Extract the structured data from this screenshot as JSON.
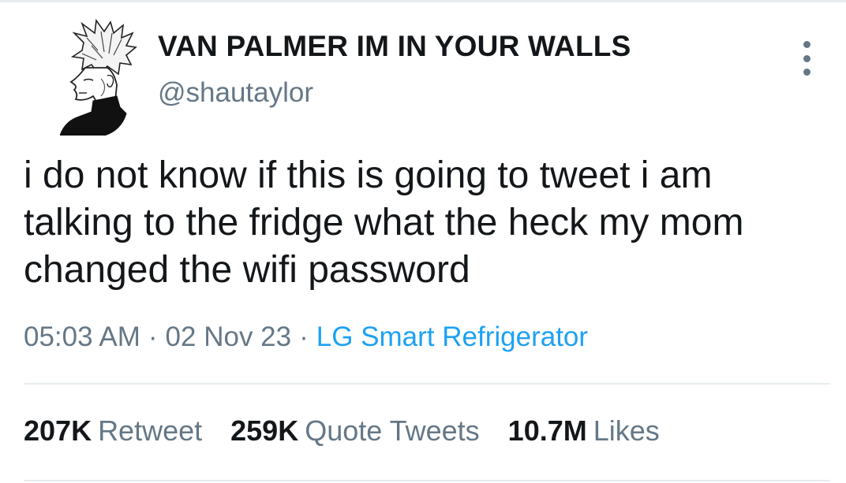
{
  "tweet": {
    "display_name": "VAN PALMER IM IN YOUR WALLS",
    "handle": "@shautaylor",
    "text": "i do not know if this is going to tweet i am talking to the fridge what the heck my mom changed the wifi password",
    "time": "05:03 AM",
    "date": "02 Nov 23",
    "separator": "·",
    "source": "LG Smart Refrigerator"
  },
  "stats": [
    {
      "count": "207K",
      "label": "Retweet"
    },
    {
      "count": "259K",
      "label": "Quote Tweets"
    },
    {
      "count": "10.7M",
      "label": "Likes"
    }
  ],
  "icons": {
    "more": "more-vertical-icon",
    "avatar": "avatar-sketch"
  },
  "colors": {
    "text": "#14171a",
    "secondary": "#657786",
    "link": "#1da1f2",
    "divider": "#e6ecf0"
  }
}
